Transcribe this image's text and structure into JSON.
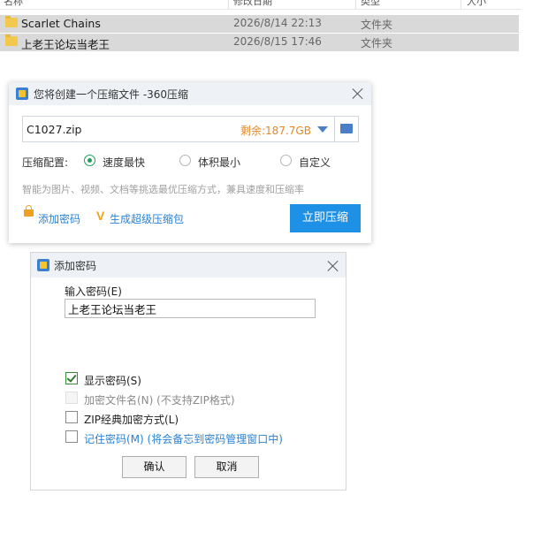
{
  "file_list": {
    "columns": [
      "名称",
      "修改日期",
      "类型",
      "大小"
    ],
    "rows": [
      {
        "name": "Scarlet Chains",
        "date": "2026/8/14 22:13",
        "type": "文件夹"
      },
      {
        "name": "上老王论坛当老王",
        "date": "2026/8/15 17:46",
        "type": "文件夹"
      }
    ]
  },
  "compress_dialog": {
    "title": "您将创建一个压缩文件 -360压缩",
    "filename": "C1027.zip",
    "free_space": "剩余:187.7GB",
    "config_label": "压缩配置:",
    "options": [
      "速度最快",
      "体积最小",
      "自定义"
    ],
    "selected_option": "速度最快",
    "hint": "智能为图片、视频、文档等挑选最优压缩方式，兼具速度和压缩率",
    "add_password": "添加密码",
    "super_pack": "生成超级压缩包",
    "compress_now": "立即压缩",
    "accent_color": "#1e90e6"
  },
  "password_dialog": {
    "title": "添加密码",
    "input_label": "输入密码(E)",
    "password_value": "上老王论坛当老王",
    "show_password": "显示密码(S)",
    "encrypt_filenames": "加密文件名(N) (不支持ZIP格式)",
    "zip_classic": "ZIP经典加密方式(L)",
    "remember_password": "记住密码(M) (将会备忘到密码管理窗口中)",
    "ok": "确认",
    "cancel": "取消",
    "show_password_checked": true
  }
}
